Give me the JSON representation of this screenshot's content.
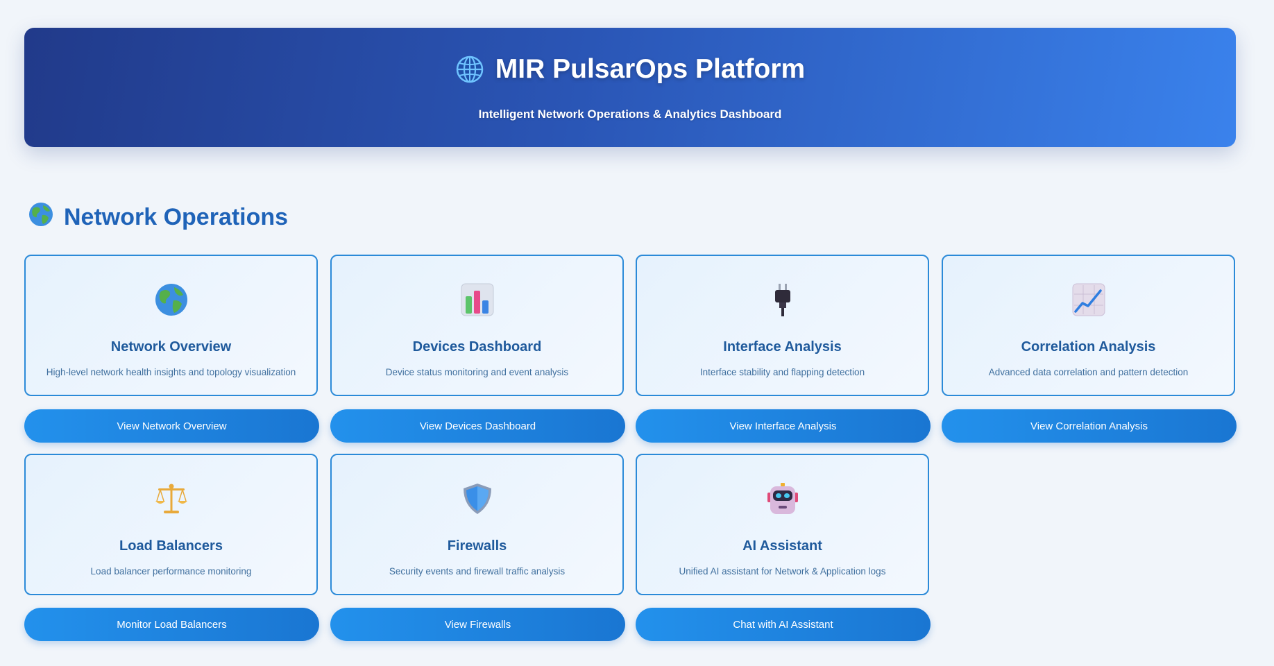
{
  "header": {
    "title": "MIR PulsarOps Platform",
    "subtitle": "Intelligent Network Operations & Analytics Dashboard",
    "icon": "globe-meridians-icon"
  },
  "section": {
    "title": "Network Operations",
    "icon": "earth-globe-icon"
  },
  "cards": [
    {
      "title": "Network Overview",
      "description": "High-level network health insights and topology visualization",
      "button_label": "View Network Overview",
      "icon": "earth-globe-icon"
    },
    {
      "title": "Devices Dashboard",
      "description": "Device status monitoring and event analysis",
      "button_label": "View Devices Dashboard",
      "icon": "bar-chart-icon"
    },
    {
      "title": "Interface Analysis",
      "description": "Interface stability and flapping detection",
      "button_label": "View Interface Analysis",
      "icon": "electric-plug-icon"
    },
    {
      "title": "Correlation Analysis",
      "description": "Advanced data correlation and pattern detection",
      "button_label": "View Correlation Analysis",
      "icon": "trend-chart-icon"
    },
    {
      "title": "Load Balancers",
      "description": "Load balancer performance monitoring",
      "button_label": "Monitor Load Balancers",
      "icon": "balance-scale-icon"
    },
    {
      "title": "Firewalls",
      "description": "Security events and firewall traffic analysis",
      "button_label": "View Firewalls",
      "icon": "shield-icon"
    },
    {
      "title": "AI Assistant",
      "description": "Unified AI assistant for Network & Application logs",
      "button_label": "Chat with AI Assistant",
      "icon": "robot-icon"
    }
  ],
  "colors": {
    "accent": "#1f63b8",
    "button": "#2391ec",
    "card_border": "#2b8ad8",
    "header_start": "#213a8a",
    "header_end": "#3a82ec"
  }
}
